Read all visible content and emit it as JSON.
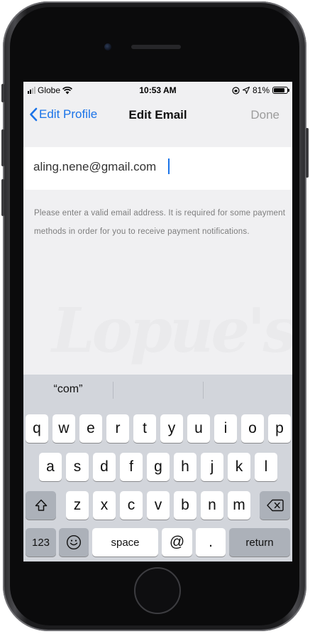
{
  "status_bar": {
    "carrier": "Globe",
    "time": "10:53 AM",
    "battery_percent": "81%",
    "battery_level": 0.81,
    "signal_bars_filled": 2,
    "signal_bars_total": 4
  },
  "nav": {
    "back_label": "Edit Profile",
    "title": "Edit Email",
    "done_label": "Done"
  },
  "email": {
    "value": "aling.nene@gmail.com"
  },
  "helper_text": "Please enter a valid email address. It is required for some payment methods in order for you to receive payment notifications.",
  "watermark_text": "Lopue's",
  "keyboard": {
    "suggestions": [
      "“com”",
      "",
      ""
    ],
    "row1": [
      "q",
      "w",
      "e",
      "r",
      "t",
      "y",
      "u",
      "i",
      "o",
      "p"
    ],
    "row2": [
      "a",
      "s",
      "d",
      "f",
      "g",
      "h",
      "j",
      "k",
      "l"
    ],
    "row3": [
      "z",
      "x",
      "c",
      "v",
      "b",
      "n",
      "m"
    ],
    "numbers_label": "123",
    "space_label": "space",
    "at_label": "@",
    "dot_label": ".",
    "return_label": "return"
  },
  "colors": {
    "accent": "#1a73e8",
    "done_disabled": "#9c9c9c",
    "keyboard_bg": "#d2d5db"
  },
  "icons": [
    "chevron-left-icon",
    "wifi-icon",
    "location-icon",
    "lock-rotation-icon",
    "battery-icon",
    "shift-icon",
    "backspace-icon",
    "emoji-icon"
  ]
}
